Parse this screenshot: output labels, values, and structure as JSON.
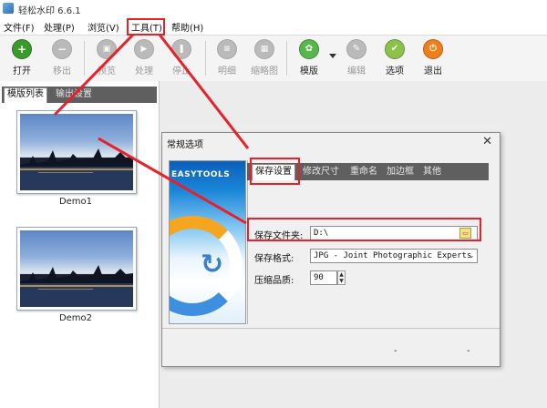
{
  "window": {
    "title": "轻松水印 6.6.1"
  },
  "menu": [
    {
      "label": "文件(F)"
    },
    {
      "label": "处理(P)"
    },
    {
      "label": "浏览(V)"
    },
    {
      "label": "工具(T)"
    },
    {
      "label": "帮助(H)"
    }
  ],
  "toolbar": [
    {
      "label": "打开",
      "icon": "plus-icon",
      "color": "#3b9a2c",
      "enabled": true
    },
    {
      "label": "移出",
      "icon": "minus-icon",
      "color": "#8b8b8b",
      "enabled": false
    },
    {
      "label": "预览",
      "icon": "preview-icon",
      "color": "#8b8b8b",
      "enabled": false
    },
    {
      "label": "处理",
      "icon": "play-icon",
      "color": "#8b8b8b",
      "enabled": false
    },
    {
      "label": "停止",
      "icon": "stop-icon",
      "color": "#8b8b8b",
      "enabled": false
    },
    {
      "label": "明细",
      "icon": "detail-icon",
      "color": "#8b8b8b",
      "enabled": false
    },
    {
      "label": "缩略图",
      "icon": "thumbnail-icon",
      "color": "#8b8b8b",
      "enabled": false
    },
    {
      "label": "模版",
      "icon": "template-icon",
      "color": "#56b848",
      "enabled": true
    },
    {
      "label": "编辑",
      "icon": "edit-icon",
      "color": "#8b8b8b",
      "enabled": false
    },
    {
      "label": "选项",
      "icon": "options-icon",
      "color": "#8bc34a",
      "enabled": true
    },
    {
      "label": "退出",
      "icon": "exit-icon",
      "color": "#f07f1a",
      "enabled": true
    }
  ],
  "left_panel": {
    "tabs": [
      {
        "label": "模版列表"
      },
      {
        "label": "输出设置"
      }
    ],
    "thumbnails": [
      {
        "caption": "Demo1"
      },
      {
        "caption": "Demo2"
      }
    ]
  },
  "dialog": {
    "title": "常规选项",
    "close": "✕",
    "brand": "EASYTOOLS",
    "tabs": [
      {
        "label": "保存设置"
      },
      {
        "label": "修改尺寸"
      },
      {
        "label": "重命名"
      },
      {
        "label": "加边框"
      },
      {
        "label": "其他"
      }
    ],
    "save_folder": {
      "label": "保存文件夹:",
      "value": "D:\\"
    },
    "save_format": {
      "label": "保存格式:",
      "value": "JPG - Joint Photographic Experts"
    },
    "quality": {
      "label": "压缩品质:",
      "value": "90"
    },
    "bottom_marks": [
      "-",
      "-"
    ]
  },
  "colors": {
    "annotation_red": "#e8202a",
    "tab_bar": "#5f5f5f"
  }
}
